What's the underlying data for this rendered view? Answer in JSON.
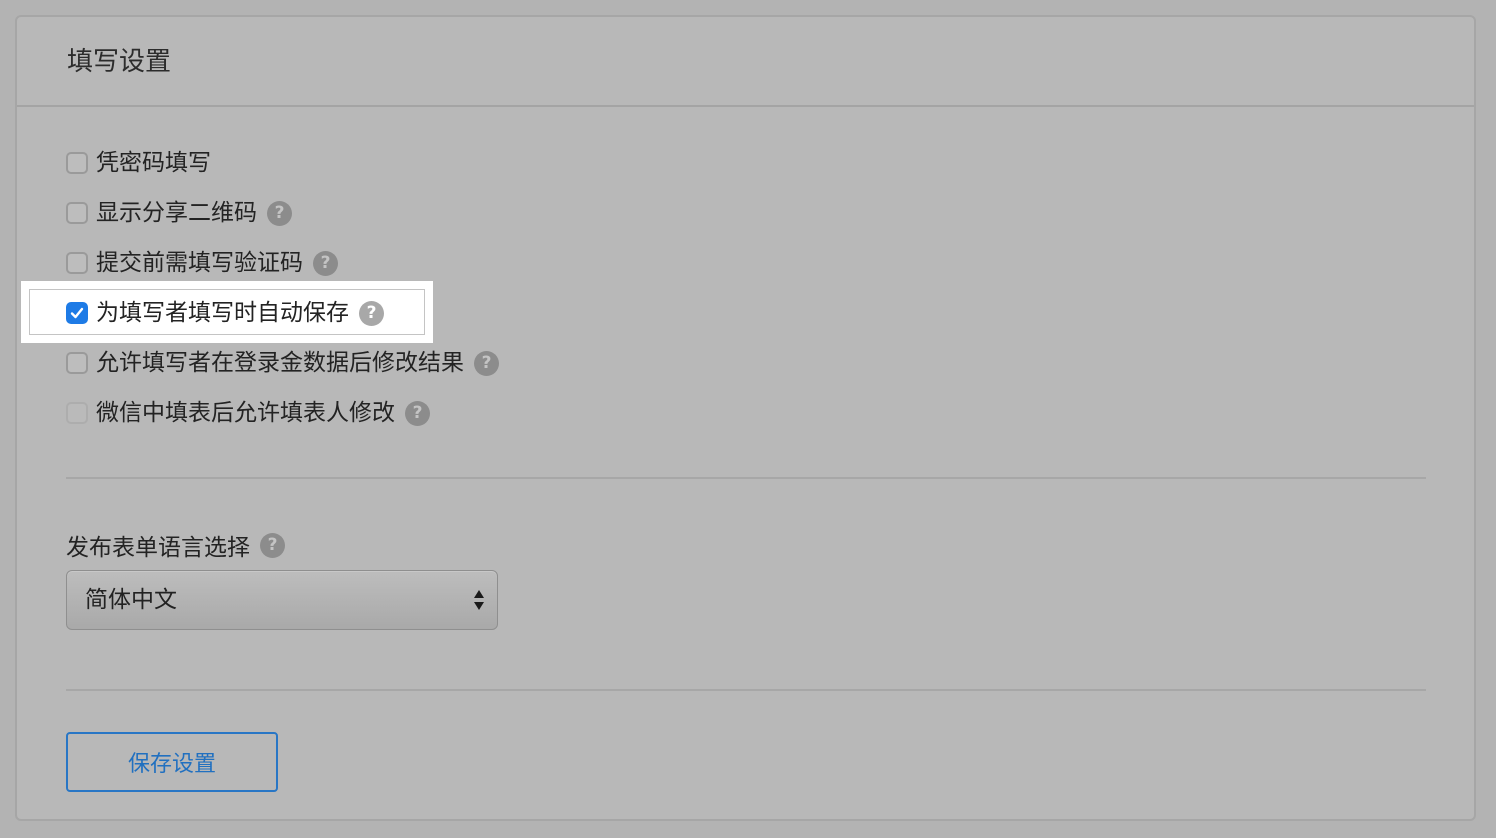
{
  "panel": {
    "title": "填写设置"
  },
  "options": [
    {
      "label": "凭密码填写",
      "checked": false,
      "help": false
    },
    {
      "label": "显示分享二维码",
      "checked": false,
      "help": true
    },
    {
      "label": "提交前需填写验证码",
      "checked": false,
      "help": true
    },
    {
      "label": "为填写者填写时自动保存",
      "checked": true,
      "help": true,
      "highlighted": true
    },
    {
      "label": "允许填写者在登录金数据后修改结果",
      "checked": false,
      "help": true
    },
    {
      "label": "微信中填表后允许填表人修改",
      "checked": false,
      "help": true,
      "disabled": true
    }
  ],
  "help_glyph": "?",
  "language": {
    "label": "发布表单语言选择",
    "selected": "简体中文"
  },
  "save_button": {
    "label": "保存设置"
  },
  "colors": {
    "accent": "#1e7be6",
    "button_border": "#2876c5",
    "background": "#b8b8b8"
  }
}
